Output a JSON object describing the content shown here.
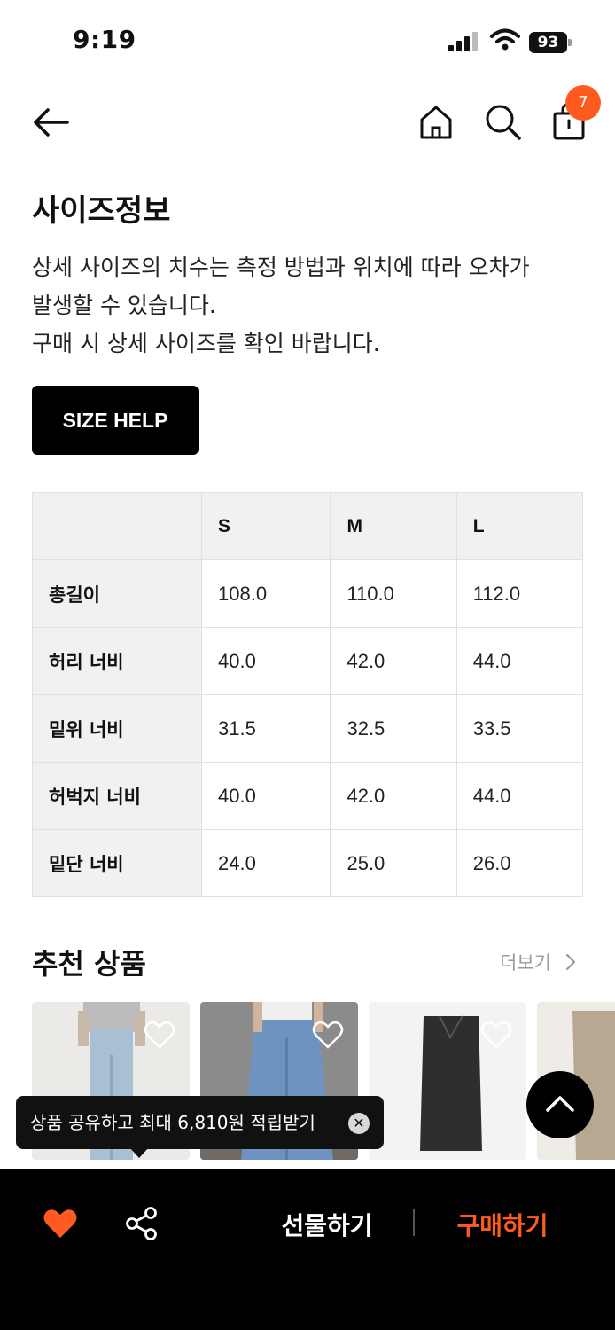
{
  "status_bar": {
    "time": "9:19",
    "battery": "93"
  },
  "nav": {
    "cart_count": "7"
  },
  "size_info": {
    "title": "사이즈정보",
    "description_lines": [
      "상세 사이즈의 치수는 측정 방법과 위치에 따라 오차가",
      "발생할 수 있습니다.",
      "구매 시 상세 사이즈를 확인 바랍니다."
    ],
    "help_button": "SIZE HELP"
  },
  "size_table": {
    "columns": [
      "S",
      "M",
      "L"
    ],
    "rows": [
      {
        "label": "총길이",
        "values": [
          "108.0",
          "110.0",
          "112.0"
        ]
      },
      {
        "label": "허리 너비",
        "values": [
          "40.0",
          "42.0",
          "44.0"
        ]
      },
      {
        "label": "밑위 너비",
        "values": [
          "31.5",
          "32.5",
          "33.5"
        ]
      },
      {
        "label": "허벅지 너비",
        "values": [
          "40.0",
          "42.0",
          "44.0"
        ]
      },
      {
        "label": "밑단 너비",
        "values": [
          "24.0",
          "25.0",
          "26.0"
        ]
      }
    ]
  },
  "recommended": {
    "title": "추천 상품",
    "more_label": "더보기"
  },
  "tooltip": {
    "text": "상품 공유하고 최대 6,810원 적립받기"
  },
  "bottom_bar": {
    "gift_label": "선물하기",
    "buy_label": "구매하기",
    "accent_color": "#ff5a1f"
  },
  "icons": [
    "back-arrow-icon",
    "home-icon",
    "search-icon",
    "shopping-bag-icon",
    "heart-icon",
    "share-icon",
    "chevron-up-icon",
    "close-icon"
  ]
}
